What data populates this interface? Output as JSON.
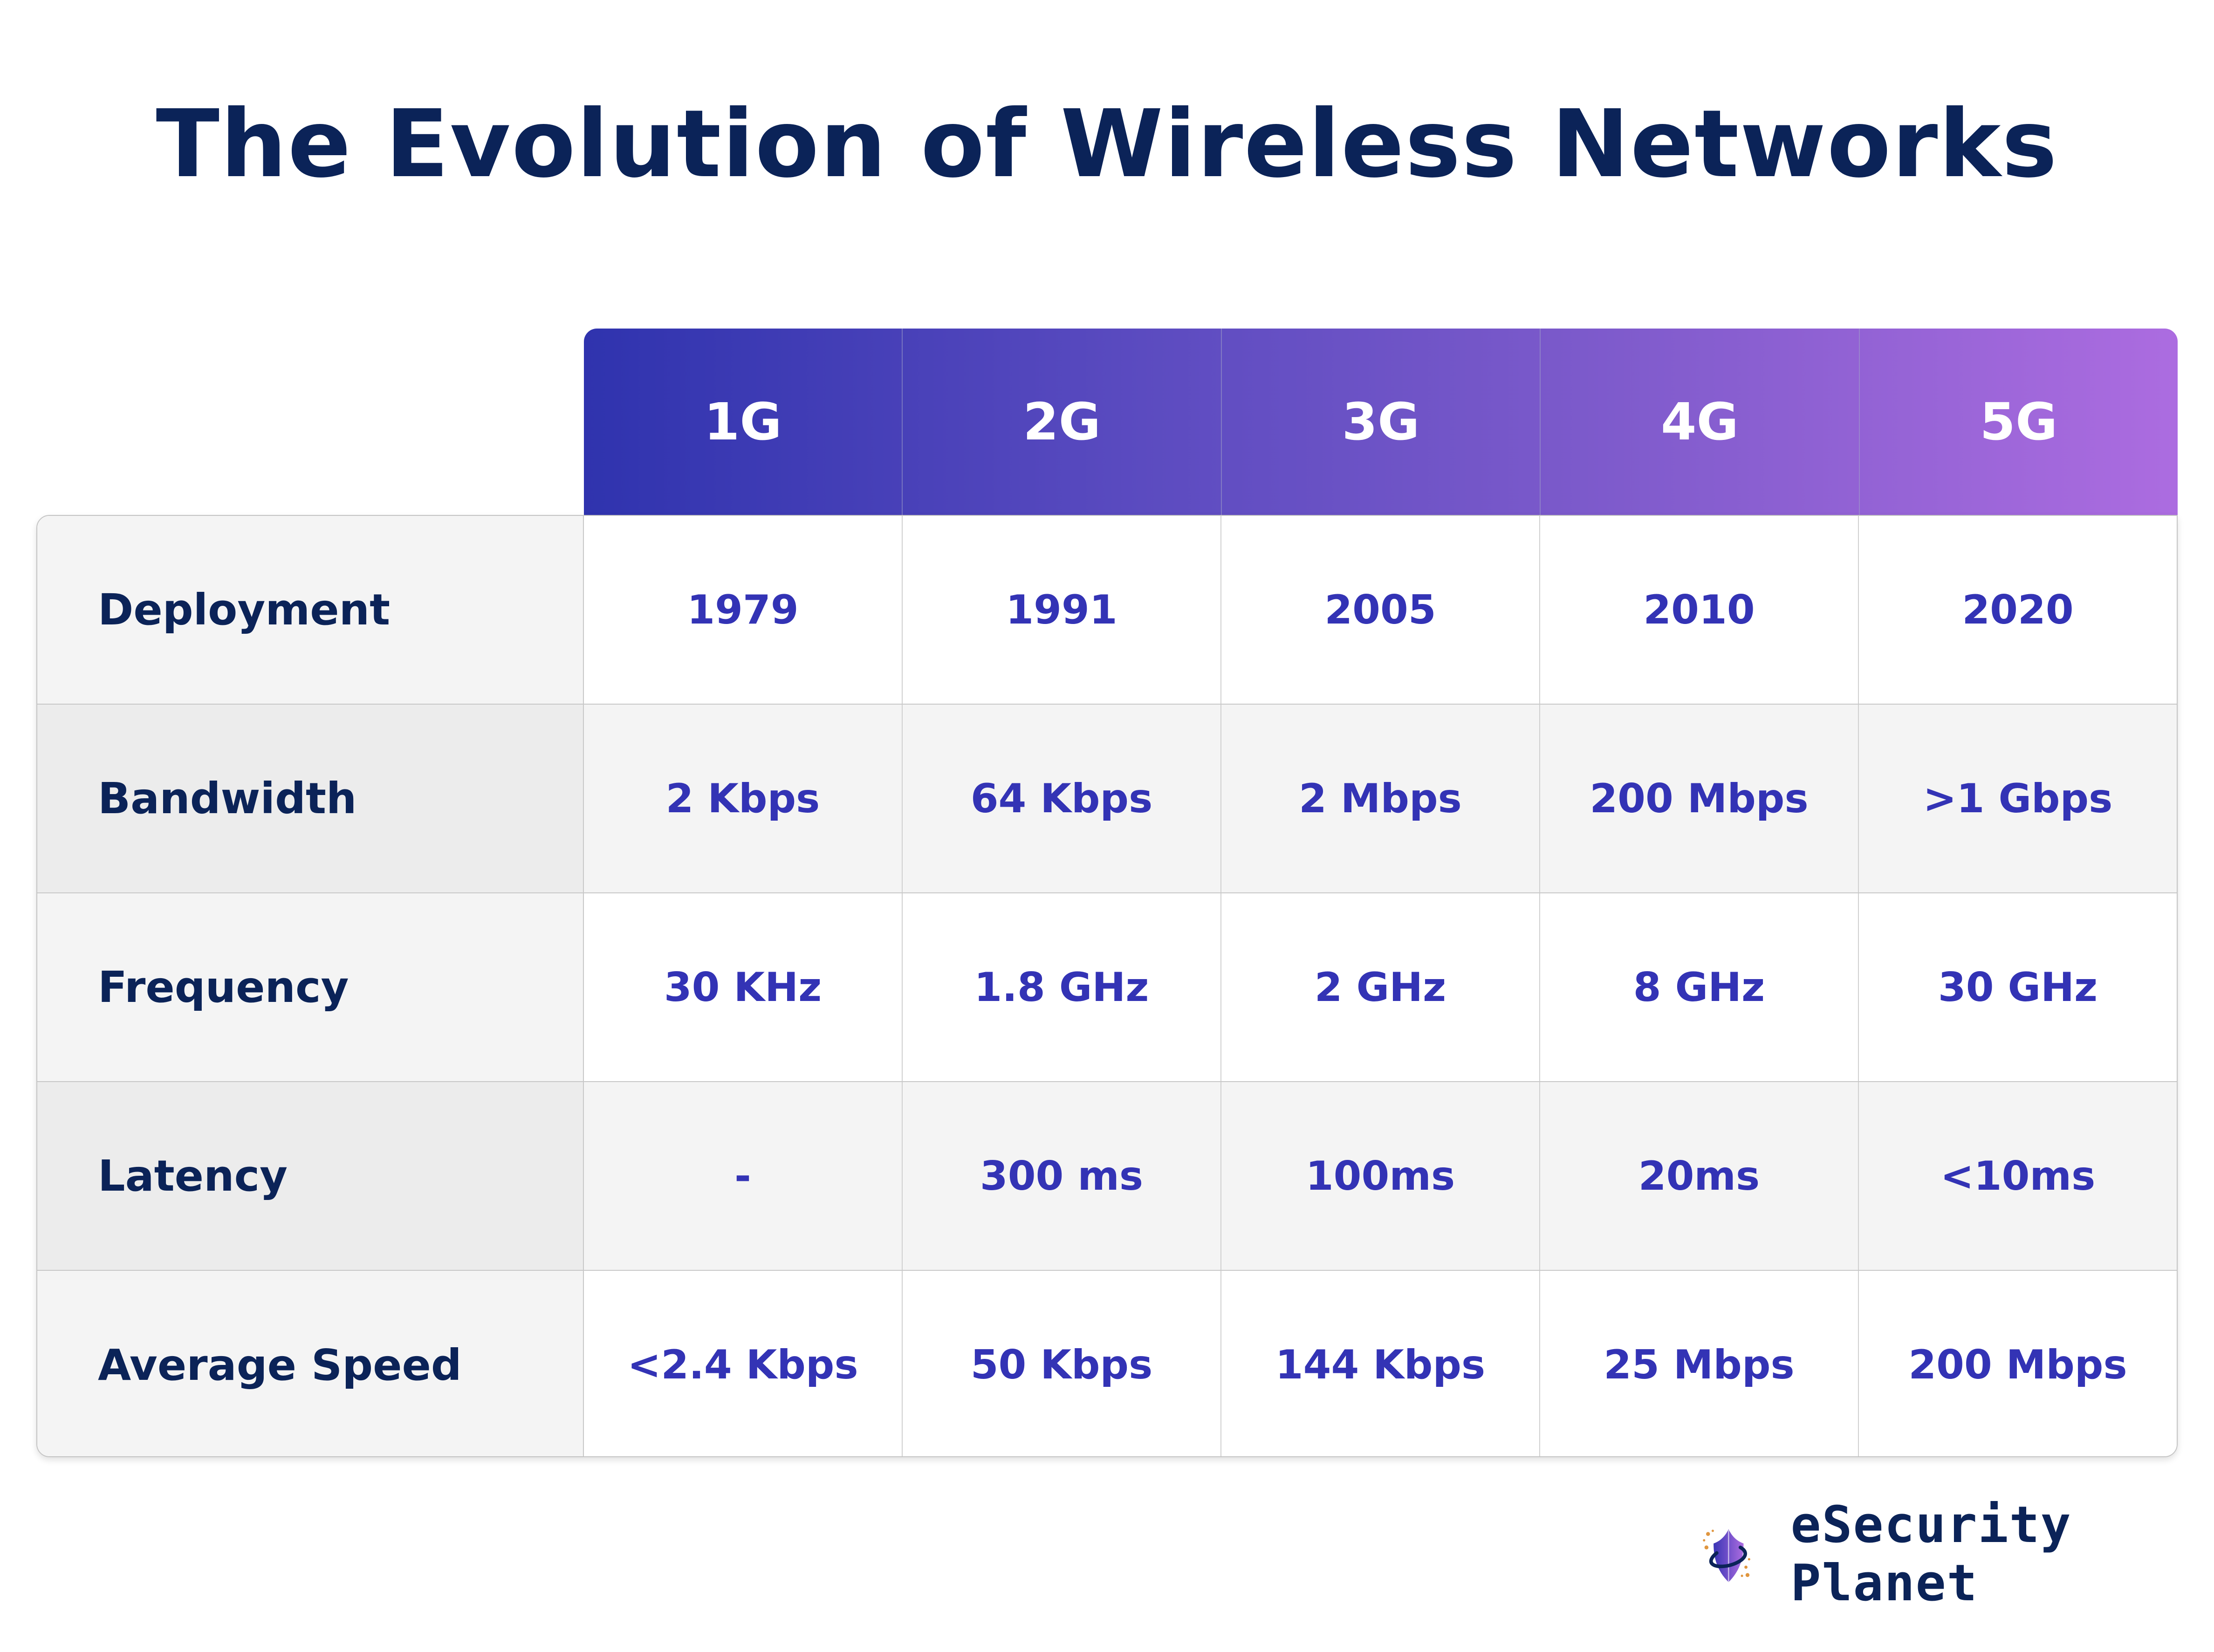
{
  "title": "The Evolution of Wireless Networks",
  "table": {
    "columns": [
      "1G",
      "2G",
      "3G",
      "4G",
      "5G"
    ],
    "rows": [
      {
        "label": "Deployment",
        "values": [
          "1979",
          "1991",
          "2005",
          "2010",
          "2020"
        ]
      },
      {
        "label": "Bandwidth",
        "values": [
          "2 Kbps",
          "64 Kbps",
          "2 Mbps",
          "200 Mbps",
          ">1 Gbps"
        ]
      },
      {
        "label": "Frequency",
        "values": [
          "30 KHz",
          "1.8 GHz",
          "2 GHz",
          "8 GHz",
          "30 GHz"
        ]
      },
      {
        "label": "Latency",
        "values": [
          "-",
          "300 ms",
          "100ms",
          "20ms",
          "<10ms"
        ]
      },
      {
        "label": "Average Speed",
        "values": [
          "<2.4 Kbps",
          "50 Kbps",
          "144 Kbps",
          "25 Mbps",
          "200 Mbps"
        ]
      }
    ]
  },
  "brand": {
    "name": "eSecurity Planet",
    "icon": "shield-planet-icon"
  },
  "colors": {
    "title": "#0b2358",
    "value_text": "#3333b5",
    "header_gradient_start": "#2f33ae",
    "header_gradient_end": "#ac6ce0",
    "accent_dots": "#e0963f"
  }
}
